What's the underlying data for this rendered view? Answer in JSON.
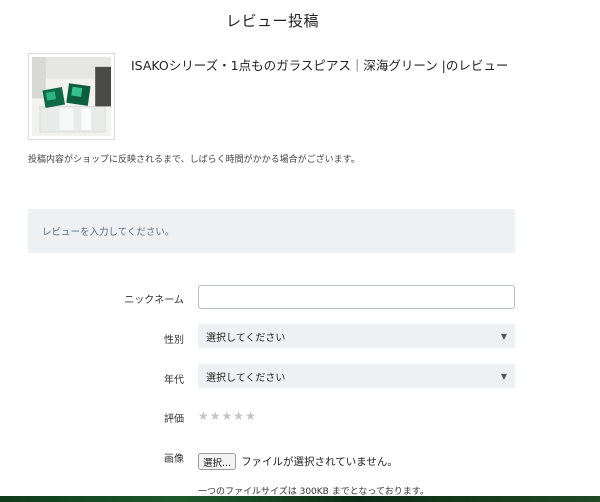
{
  "page": {
    "title": "レビュー投稿"
  },
  "product": {
    "name": "ISAKOシリーズ・1点ものガラスピアス｜深海グリーン |のレビュー",
    "image_icon": "green-glass-earring-photo"
  },
  "notice": "投稿内容がショップに反映されるまで、しばらく時間がかかる場合がございます。",
  "info_box": {
    "message": "レビューを入力してください。"
  },
  "form": {
    "nickname": {
      "label": "ニックネーム",
      "value": "",
      "placeholder": ""
    },
    "gender": {
      "label": "性別",
      "selected": "選択してください"
    },
    "age": {
      "label": "年代",
      "selected": "選択してください"
    },
    "rating": {
      "label": "評価",
      "value": 0,
      "max": 5
    },
    "image": {
      "label": "画像",
      "button_label": "選択...",
      "status": "ファイルが選択されていません。",
      "size_note": "一つのファイルサイズは 300KB までとなっております。"
    }
  },
  "colors": {
    "panel_bg": "#eef1f3",
    "info_text": "#5b6f82",
    "star_empty": "#c4c4c4"
  }
}
